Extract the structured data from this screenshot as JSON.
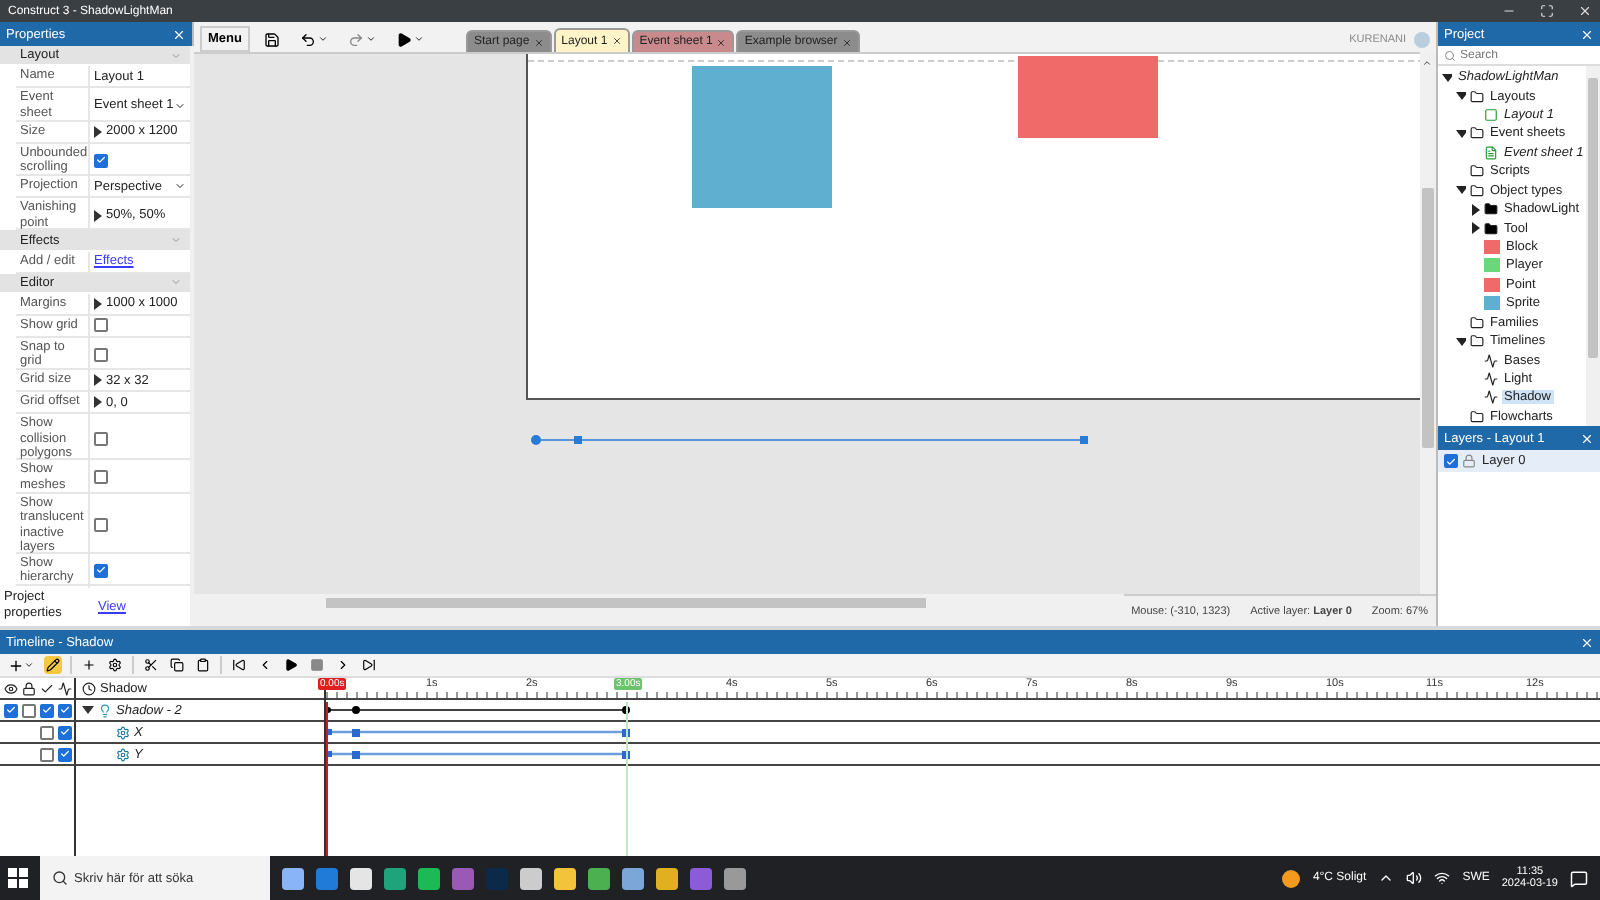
{
  "window": {
    "title": "Construct 3 - ShadowLightMan"
  },
  "properties": {
    "title": "Properties",
    "sections": [
      {
        "title": "Layout",
        "rows": [
          {
            "label": "Name",
            "kind": "text",
            "value": "Layout 1"
          },
          {
            "label": "Event sheet",
            "kind": "select",
            "value": "Event sheet 1"
          },
          {
            "label": "Size",
            "kind": "expander",
            "value": "2000 x 1200"
          },
          {
            "label": "Unbounded scrolling",
            "kind": "checkbox",
            "checked": true
          },
          {
            "label": "Projection",
            "kind": "select",
            "value": "Perspective"
          },
          {
            "label": "Vanishing point",
            "kind": "expander",
            "value": "50%, 50%"
          }
        ]
      },
      {
        "title": "Effects",
        "rows": [
          {
            "label": "Add / edit",
            "kind": "link",
            "value": "Effects"
          }
        ]
      },
      {
        "title": "Editor",
        "rows": [
          {
            "label": "Margins",
            "kind": "expander",
            "value": "1000 x 1000"
          },
          {
            "label": "Show grid",
            "kind": "checkbox",
            "checked": false
          },
          {
            "label": "Snap to grid",
            "kind": "checkbox",
            "checked": false
          },
          {
            "label": "Grid size",
            "kind": "expander",
            "value": "32 x 32"
          },
          {
            "label": "Grid offset",
            "kind": "expander",
            "value": "0, 0"
          },
          {
            "label": "Show collision polygons",
            "kind": "checkbox",
            "checked": false
          },
          {
            "label": "Show meshes",
            "kind": "checkbox",
            "checked": false
          },
          {
            "label": "Show translucent inactive layers",
            "kind": "checkbox",
            "checked": false
          },
          {
            "label": "Show hierarchy",
            "kind": "checkbox",
            "checked": true
          }
        ]
      }
    ],
    "footer": {
      "label": "Project properties",
      "link": "View"
    }
  },
  "toolbar": {
    "menu": "Menu"
  },
  "tabs": [
    {
      "label": "Start page",
      "selected": false,
      "color": "#8c8c8c"
    },
    {
      "label": "Layout 1",
      "selected": true,
      "color": "#fff4c8"
    },
    {
      "label": "Event sheet 1",
      "selected": false,
      "color": "#c98a8d"
    },
    {
      "label": "Example browser",
      "selected": false,
      "color": "#8c8c8c"
    }
  ],
  "user": "KURENANI",
  "status": {
    "mouse": "Mouse: (-310, 1323)",
    "layer_label": "Active layer:",
    "layer": "Layer 0",
    "zoom": "Zoom: 67%"
  },
  "project": {
    "title": "Project",
    "search_placeholder": "Search",
    "tree": [
      {
        "name": "ShadowLightMan",
        "kind": "root",
        "expanded": true,
        "children": [
          {
            "name": "Layouts",
            "kind": "folder",
            "expanded": true,
            "children": [
              {
                "name": "Layout 1",
                "kind": "layout"
              }
            ]
          },
          {
            "name": "Event sheets",
            "kind": "folder",
            "expanded": true,
            "children": [
              {
                "name": "Event sheet 1",
                "kind": "sheet"
              }
            ]
          },
          {
            "name": "Scripts",
            "kind": "folder"
          },
          {
            "name": "Object types",
            "kind": "folder",
            "expanded": true,
            "children": [
              {
                "name": "ShadowLight",
                "kind": "group",
                "expanded": false
              },
              {
                "name": "Tool",
                "kind": "group",
                "expanded": false
              },
              {
                "name": "Block",
                "kind": "object",
                "color": "#f06a6a"
              },
              {
                "name": "Player",
                "kind": "object",
                "color": "#6ad87a"
              },
              {
                "name": "Point",
                "kind": "object",
                "color": "#f06a6a"
              },
              {
                "name": "Sprite",
                "kind": "object",
                "color": "#5fb0d0"
              }
            ]
          },
          {
            "name": "Families",
            "kind": "folder"
          },
          {
            "name": "Timelines",
            "kind": "folder",
            "expanded": true,
            "children": [
              {
                "name": "Bases",
                "kind": "timeline",
                "selected": false
              },
              {
                "name": "Light",
                "kind": "timeline",
                "selected": false
              },
              {
                "name": "Shadow",
                "kind": "timeline",
                "selected": true
              }
            ]
          },
          {
            "name": "Flowcharts",
            "kind": "folder"
          }
        ]
      }
    ]
  },
  "layers": {
    "title": "Layers - Layout 1",
    "items": [
      {
        "name": "Layer 0",
        "visible": true,
        "locked": false
      }
    ]
  },
  "timeline": {
    "title": "Timeline - Shadow",
    "header": "Shadow",
    "playhead": "0.00s",
    "end_marker": "3.00s",
    "ticks": [
      "1s",
      "2s",
      "4s",
      "5s",
      "6s",
      "7s",
      "8s",
      "9s",
      "10s",
      "11s",
      "12s"
    ],
    "tracks": [
      {
        "name": "Shadow - 2",
        "visible": true,
        "locked": false,
        "enabled": true,
        "graph": true,
        "expanded": true,
        "children": [
          {
            "name": "X",
            "locked": false,
            "enabled": true
          },
          {
            "name": "Y",
            "locked": false,
            "enabled": true
          }
        ]
      }
    ]
  },
  "taskbar": {
    "search_placeholder": "Skriv här för att söka",
    "weather": "4°C  Soligt",
    "lang": "SWE",
    "time": "11:35",
    "date": "2024-03-19"
  }
}
